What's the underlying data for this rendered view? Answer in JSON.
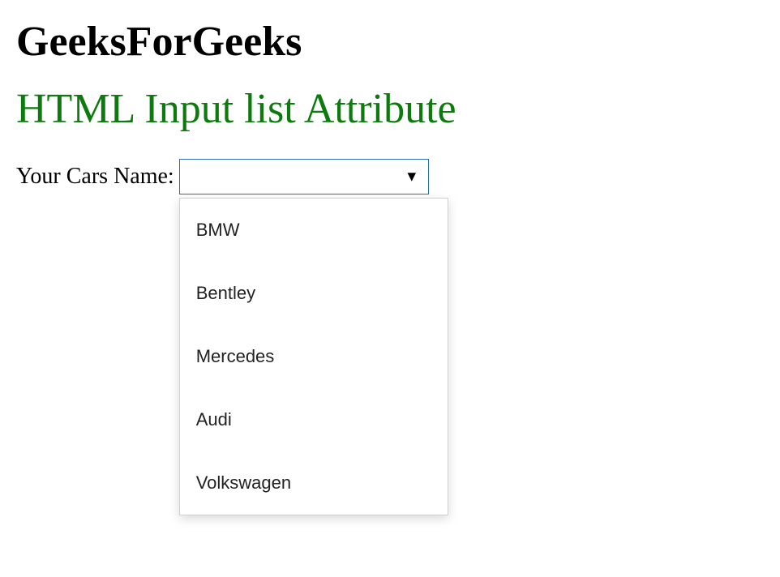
{
  "headings": {
    "site_title": "GeeksForGeeks",
    "page_title": "HTML Input list Attribute"
  },
  "form": {
    "label": "Your Cars Name:",
    "input_value": "",
    "options": [
      "BMW",
      "Bentley",
      "Mercedes",
      "Audi",
      "Volkswagen"
    ]
  }
}
